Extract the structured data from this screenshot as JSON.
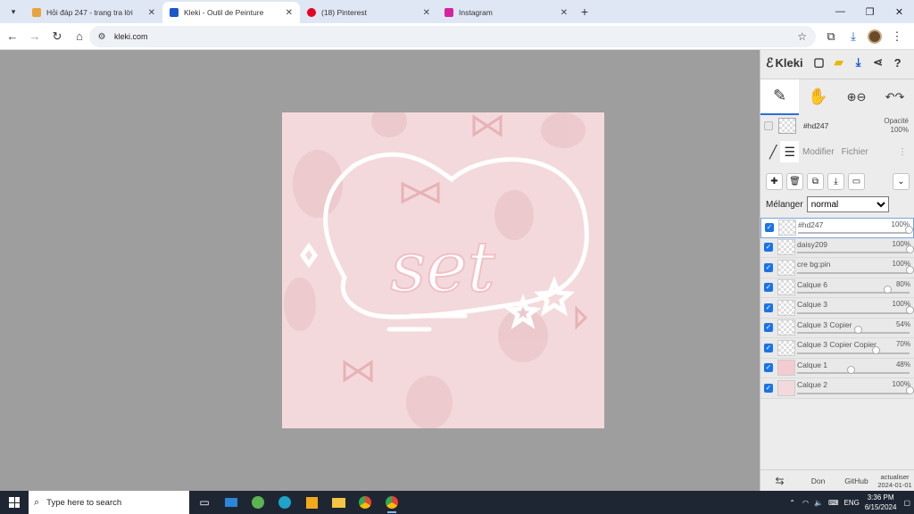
{
  "browser": {
    "tabs": [
      {
        "title": "Hỏi đáp 247 - trang tra lời",
        "fav_color": "#e8a33d",
        "active": false
      },
      {
        "title": "Kleki - Outil de Peinture",
        "fav_color": "#1a57c9",
        "active": true
      },
      {
        "title": "(18) Pinterest",
        "fav_color": "#e60023",
        "active": false
      },
      {
        "title": "Instagram",
        "fav_color": "#d6249f",
        "active": false
      }
    ],
    "url": "kleki.com"
  },
  "app": {
    "logo": "Kleki",
    "current_layer_label": "#hd247",
    "opacity_label": "Opacité",
    "opacity_value": "100%",
    "panel_tabs": [
      "Modifier",
      "Fichier"
    ],
    "blend_label": "Mélanger",
    "blend_value": "normal",
    "layers": [
      {
        "name": "#hd247",
        "opacity": "100%",
        "opacity_value": 100,
        "selected": true
      },
      {
        "name": "daisy209",
        "opacity": "100%",
        "opacity_value": 100,
        "selected": false
      },
      {
        "name": "cre bg:pin",
        "opacity": "100%",
        "opacity_value": 100,
        "selected": false
      },
      {
        "name": "Calque 6",
        "opacity": "80%",
        "opacity_value": 80,
        "selected": false
      },
      {
        "name": "Calque 3",
        "opacity": "100%",
        "opacity_value": 100,
        "selected": false
      },
      {
        "name": "Calque 3 Copier",
        "opacity": "54%",
        "opacity_value": 54,
        "selected": false
      },
      {
        "name": "Calque 3 Copier Copier",
        "opacity": "70%",
        "opacity_value": 70,
        "selected": false
      },
      {
        "name": "Calque 1",
        "opacity": "48%",
        "opacity_value": 48,
        "selected": false
      },
      {
        "name": "Calque 2",
        "opacity": "100%",
        "opacity_value": 100,
        "selected": false
      }
    ],
    "footer": {
      "don": "Don",
      "github": "GitHub",
      "update_label": "actualiser",
      "update_date": "2024-01-01"
    },
    "canvas_text": "set"
  },
  "taskbar": {
    "search_placeholder": "Type here to search",
    "lang": "ENG",
    "time": "3:36 PM",
    "date": "6/15/2024"
  }
}
